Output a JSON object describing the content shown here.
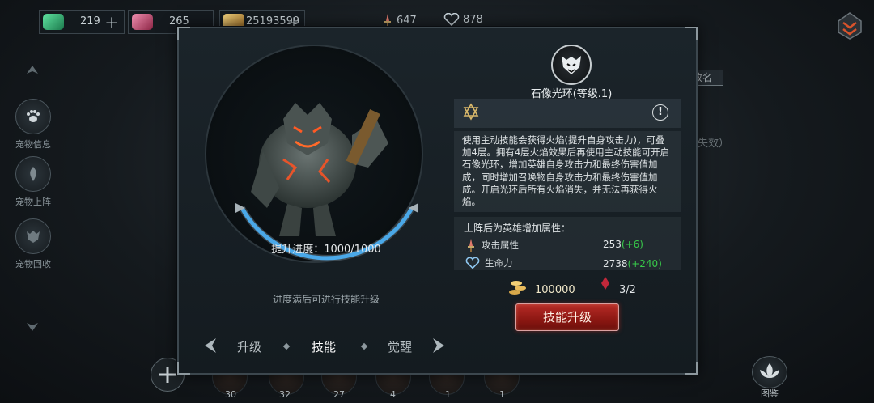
{
  "resources": {
    "green_gem": "219",
    "red_gem": "265",
    "gold": "25193599"
  },
  "top_stats": {
    "attack": "647",
    "health": "878"
  },
  "side_menu": [
    {
      "label": "宠物信息"
    },
    {
      "label": "宠物上阵"
    },
    {
      "label": "宠物回收"
    }
  ],
  "background": {
    "rename_label": "改名",
    "status_text": "失效）",
    "gallery_label": "图鉴",
    "counts": [
      "30",
      "32",
      "27",
      "4",
      "1",
      "1"
    ]
  },
  "panel": {
    "progress_label": "提升进度：1000/1000",
    "progress_value": 1.0,
    "hint": "进度满后可进行技能升级",
    "tabs": [
      {
        "label": "升级"
      },
      {
        "label": "技能"
      },
      {
        "label": "觉醒"
      }
    ],
    "active_tab": "技能",
    "skill": {
      "title": "石像光环(等级.1)",
      "description": "使用主动技能会获得火焰(提升自身攻击力)，可叠加4层。拥有4层火焰效果后再使用主动技能可开启石像光环，增加英雄自身攻击力和最终伤害值加成，同时增加召唤物自身攻击力和最终伤害值加成。开启光环后所有火焰消失，并无法再获得火焰。"
    },
    "bonus": {
      "heading": "上阵后为英雄增加属性：",
      "rows": [
        {
          "label": "攻击属性",
          "value": "253",
          "plus": "(+6)"
        },
        {
          "label": "生命力",
          "value": "2738",
          "plus": "(+240)"
        }
      ]
    },
    "cost": {
      "gold": "100000",
      "crystal": "3/2"
    },
    "upgrade_button": "技能升级"
  },
  "colors": {
    "accent_red": "#9c1c16",
    "plus_green": "#38c94a",
    "progress_blue": "#4aa8e8"
  }
}
